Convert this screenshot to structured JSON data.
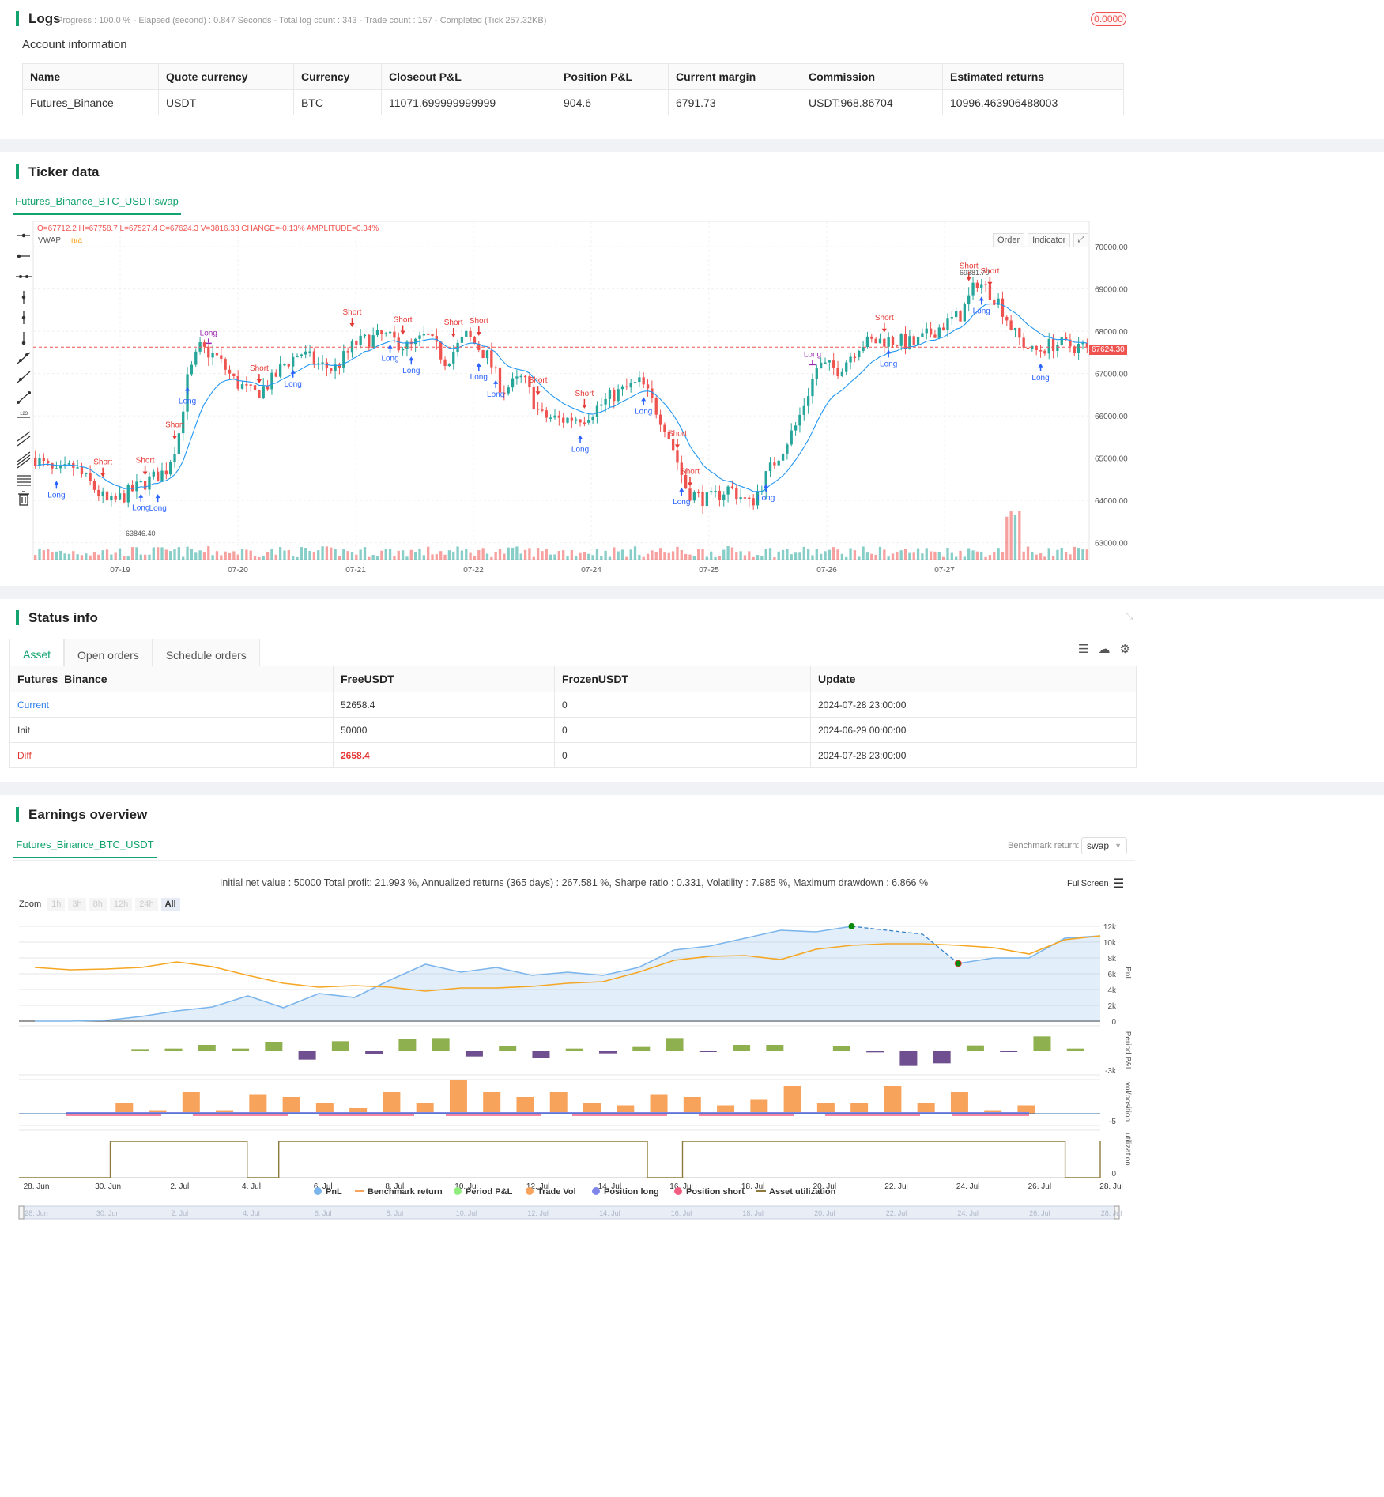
{
  "logs": {
    "title": "Logs",
    "status": "Progress : 100.0 % - Elapsed (second) : 0.847  Seconds - Total log count : 343 - Trade count : 157 - Completed (Tick 257.32KB)",
    "badge": "0.0000",
    "account_title": "Account information",
    "columns": [
      "Name",
      "Quote currency",
      "Currency",
      "Closeout P&L",
      "Position P&L",
      "Current margin",
      "Commission",
      "Estimated returns"
    ],
    "row": [
      "Futures_Binance",
      "USDT",
      "BTC",
      "11071.699999999999",
      "904.6",
      "6791.73",
      "USDT:968.86704",
      "10996.463906488003"
    ]
  },
  "ticker": {
    "title": "Ticker data",
    "tab": "Futures_Binance_BTC_USDT:swap",
    "ohlc_line": "O=67712.2 H=67758.7 L=67527.4 C=67624.3 V=3816.33 CHANGE=-0.13% AMPLITUDE=0.34%",
    "vwap_label": "VWAP",
    "vwap_value": "n/a",
    "order_btn": "Order",
    "indicator_btn": "Indicator",
    "price_tag": "67624.30",
    "high_marker": "69381.70",
    "low_marker": "63846.40",
    "colors": {
      "up": "#26a69a",
      "down": "#ef5350",
      "vwap": "#2196f3",
      "long": "#2962ff",
      "short": "#e53935"
    }
  },
  "chart_data": {
    "type": "candlestick",
    "x_ticks": [
      "07-19",
      "07-20",
      "07-21",
      "07-22",
      "07-24",
      "07-25",
      "07-26",
      "07-27"
    ],
    "y_ticks": [
      "70000.00",
      "69000.00",
      "68000.00",
      "67000.00",
      "66000.00",
      "65000.00",
      "64000.00",
      "63000.00"
    ],
    "ylim": [
      62600,
      70600
    ],
    "last_close": 67624.3,
    "keypoints": [
      [
        0,
        65000
      ],
      [
        10,
        64600
      ],
      [
        18,
        64800
      ],
      [
        26,
        64400
      ],
      [
        35,
        63900
      ],
      [
        45,
        64200
      ],
      [
        55,
        64500
      ],
      [
        62,
        64700
      ],
      [
        68,
        65500
      ],
      [
        72,
        66800
      ],
      [
        78,
        67600
      ],
      [
        86,
        67400
      ],
      [
        95,
        66800
      ],
      [
        104,
        66500
      ],
      [
        112,
        66800
      ],
      [
        118,
        67200
      ],
      [
        126,
        67500
      ],
      [
        135,
        67200
      ],
      [
        142,
        67100
      ],
      [
        152,
        67700
      ],
      [
        165,
        67900
      ],
      [
        178,
        67600
      ],
      [
        186,
        67900
      ],
      [
        195,
        67300
      ],
      [
        205,
        67900
      ],
      [
        215,
        67400
      ],
      [
        222,
        66600
      ],
      [
        232,
        66900
      ],
      [
        240,
        66000
      ],
      [
        250,
        65900
      ],
      [
        262,
        66000
      ],
      [
        275,
        66500
      ],
      [
        288,
        66800
      ],
      [
        300,
        65700
      ],
      [
        310,
        64200
      ],
      [
        320,
        64000
      ],
      [
        330,
        64300
      ],
      [
        340,
        63900
      ],
      [
        350,
        64800
      ],
      [
        362,
        65800
      ],
      [
        372,
        67200
      ],
      [
        382,
        67100
      ],
      [
        392,
        67700
      ],
      [
        405,
        67800
      ],
      [
        418,
        67700
      ],
      [
        430,
        68100
      ],
      [
        440,
        68400
      ],
      [
        448,
        69200
      ],
      [
        458,
        68700
      ],
      [
        466,
        67900
      ],
      [
        474,
        67500
      ],
      [
        484,
        67700
      ],
      [
        494,
        67650
      ],
      [
        500,
        67624
      ]
    ],
    "long_labels": [
      [
        72,
        "Long"
      ],
      [
        370,
        "Long"
      ],
      [
        493,
        "Long"
      ],
      [
        518,
        "Long"
      ],
      [
        604,
        "Long"
      ],
      [
        628,
        "Long"
      ],
      [
        733,
        "Long"
      ],
      [
        812,
        "Long"
      ],
      [
        862,
        "Long"
      ],
      [
        971,
        "Long"
      ],
      [
        1125,
        "Long"
      ],
      [
        1244,
        "Long"
      ],
      [
        1314,
        "Long"
      ],
      [
        176,
        "Long"
      ],
      [
        201,
        "Long"
      ],
      [
        236,
        "Long"
      ]
    ],
    "short_labels": [
      [
        132,
        "Short"
      ],
      [
        181,
        "Short"
      ],
      [
        221,
        "Short"
      ],
      [
        330,
        "Short"
      ],
      [
        444,
        "Short"
      ],
      [
        509,
        "Short"
      ],
      [
        573,
        "Short"
      ],
      [
        608,
        "Short"
      ],
      [
        683,
        "Short"
      ],
      [
        737,
        "Short"
      ],
      [
        857,
        "Short"
      ],
      [
        872,
        "Short"
      ],
      [
        1120,
        "Short"
      ],
      [
        1225,
        "Short"
      ],
      [
        1254,
        "Short"
      ]
    ],
    "close_labels": [
      [
        266,
        "Long"
      ],
      [
        1030,
        "Long"
      ]
    ]
  },
  "status": {
    "title": "Status info",
    "tabs": [
      "Asset",
      "Open orders",
      "Schedule orders"
    ],
    "columns": [
      "Futures_Binance",
      "FreeUSDT",
      "FrozenUSDT",
      "Update"
    ],
    "rows": [
      [
        "Current",
        "52658.4",
        "0",
        "2024-07-28 23:00:00"
      ],
      [
        "Init",
        "50000",
        "0",
        "2024-06-29 00:00:00"
      ],
      [
        "Diff",
        "2658.4",
        "0",
        "2024-07-28 23:00:00"
      ]
    ]
  },
  "earnings": {
    "title": "Earnings overview",
    "tab": "Futures_Binance_BTC_USDT",
    "benchmark_label": "Benchmark return:",
    "benchmark_value": "swap",
    "summary": "Initial net value : 50000 Total profit: 21.993 %, Annualized returns (365 days) : 267.581 %, Sharpe ratio : 0.331, Volatility : 7.985 %, Maximum drawdown : 6.866 %",
    "fullscreen": "FullScreen",
    "zoom_label": "Zoom",
    "zoom_options": [
      "1h",
      "3h",
      "8h",
      "12h",
      "24h",
      "All"
    ],
    "pnl_ticks": [
      "12k",
      "10k",
      "8k",
      "6k",
      "4k",
      "2k",
      "0"
    ],
    "axis_titles": [
      "PnL",
      "Period P&L",
      "vol/position",
      "utilization"
    ],
    "period_tick": "-3k",
    "vol_tick": "-5",
    "util_tick": "0",
    "x_ticks": [
      "28. Jun",
      "30. Jun",
      "2. Jul",
      "4. Jul",
      "6. Jul",
      "8. Jul",
      "10. Jul",
      "12. Jul",
      "14. Jul",
      "16. Jul",
      "18. Jul",
      "20. Jul",
      "22. Jul",
      "24. Jul",
      "26. Jul",
      "28. Jul"
    ],
    "legend": [
      {
        "name": "PnL",
        "color": "#7cb5ec"
      },
      {
        "name": "Benchmark return",
        "color": "#f7a35c"
      },
      {
        "name": "Period P&L",
        "color": "#90ed7d"
      },
      {
        "name": "Trade Vol",
        "color": "#f7a35c"
      },
      {
        "name": "Position long",
        "color": "#8085e9"
      },
      {
        "name": "Position short",
        "color": "#f15c80"
      },
      {
        "name": "Asset utilization",
        "color": "#8d7a3a"
      }
    ],
    "pnl_series": [
      0,
      0,
      100,
      600,
      1300,
      1800,
      3200,
      1700,
      3500,
      3000,
      5200,
      7200,
      6200,
      6800,
      5800,
      6200,
      5800,
      6800,
      9000,
      9500,
      10500,
      11500,
      11300,
      12000,
      11500,
      11000,
      7300,
      8000,
      8000,
      10500,
      10800
    ],
    "benchmark_series": [
      6800,
      6500,
      6600,
      6800,
      7500,
      6900,
      5800,
      4800,
      4300,
      4500,
      4300,
      3800,
      4200,
      4200,
      4400,
      4800,
      5000,
      6200,
      7700,
      8200,
      8300,
      7800,
      9100,
      9600,
      9800,
      9800,
      9600,
      9300,
      8500,
      10300,
      10800
    ],
    "period_pnl": [
      0,
      400,
      500,
      1200,
      500,
      1800,
      -1600,
      1900,
      -500,
      2400,
      2500,
      -1000,
      1000,
      -1300,
      500,
      -400,
      800,
      2500,
      -100,
      1200,
      1200,
      0,
      1000,
      -200,
      -2800,
      -2300,
      1100,
      -100,
      2800,
      500
    ],
    "trade_vol": [
      0,
      4,
      1,
      8,
      1,
      7,
      6,
      4,
      2,
      8,
      4,
      12,
      8,
      6,
      8,
      4,
      3,
      7,
      6,
      3,
      5,
      10,
      4,
      4,
      10,
      4,
      8,
      1,
      3,
      0
    ],
    "utilization": [
      [
        0,
        0
      ],
      [
        2.6,
        0
      ],
      [
        2.6,
        1
      ],
      [
        6.5,
        1
      ],
      [
        6.5,
        0
      ],
      [
        7.4,
        0
      ],
      [
        7.4,
        1
      ],
      [
        17.9,
        1
      ],
      [
        17.9,
        0
      ],
      [
        18.9,
        0
      ],
      [
        18.9,
        1
      ],
      [
        29.8,
        1
      ],
      [
        29.8,
        0
      ],
      [
        30.8,
        0
      ],
      [
        30.8,
        1
      ]
    ]
  }
}
